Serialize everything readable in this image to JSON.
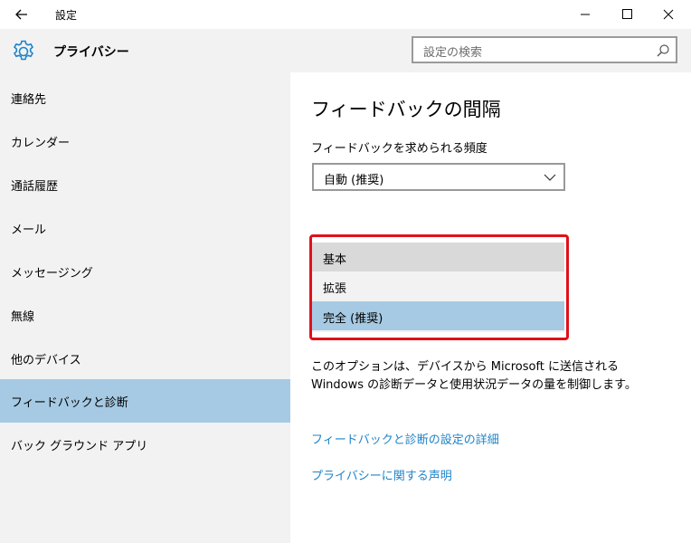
{
  "window": {
    "title": "設定"
  },
  "header": {
    "title": "プライバシー",
    "search_placeholder": "設定の検索"
  },
  "sidebar": {
    "items": [
      {
        "label": "連絡先"
      },
      {
        "label": "カレンダー"
      },
      {
        "label": "通話履歴"
      },
      {
        "label": "メール"
      },
      {
        "label": "メッセージング"
      },
      {
        "label": "無線"
      },
      {
        "label": "他のデバイス"
      },
      {
        "label": "フィードバックと診断",
        "selected": true
      },
      {
        "label": "バック グラウンド アプリ"
      }
    ]
  },
  "main": {
    "title": "フィードバックの間隔",
    "frequency_label": "フィードバックを求められる頻度",
    "frequency_value": "自動 (推奨)",
    "dropdown_options": [
      {
        "label": "基本",
        "state": "hover"
      },
      {
        "label": "拡張",
        "state": "normal"
      },
      {
        "label": "完全 (推奨)",
        "state": "selected"
      }
    ],
    "description": "このオプションは、デバイスから Microsoft に送信される Windows の診断データと使用状況データの量を制御します。",
    "links": [
      "フィードバックと診断の設定の詳細",
      "プライバシーに関する声明"
    ]
  },
  "colors": {
    "accent": "#1e84c8",
    "selection": "#a6cae3",
    "highlight_border": "#e0101a"
  },
  "icons": [
    "back-arrow-icon",
    "minimize-icon",
    "maximize-icon",
    "close-icon",
    "gear-icon",
    "search-icon",
    "chevron-down-icon"
  ]
}
